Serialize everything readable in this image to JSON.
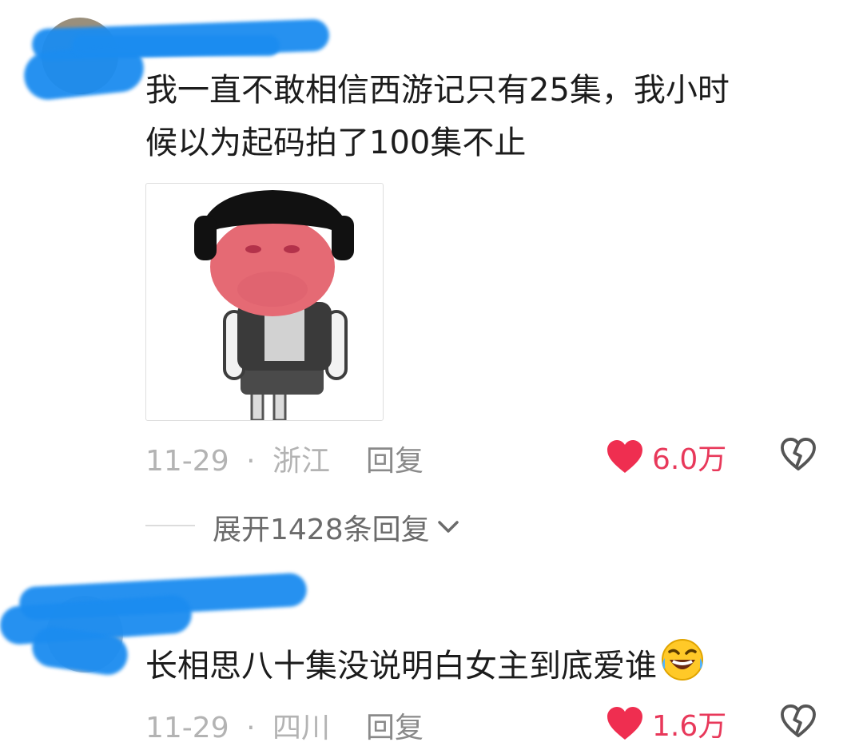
{
  "comments": [
    {
      "text_line1": "我一直不敢相信西游记只有25集，我小时",
      "text_line2": "候以为起码拍了100集不止",
      "date": "11-29",
      "separator": "·",
      "location": "浙江",
      "reply_label": "回复",
      "like_count": "6.0万",
      "has_sticker": true,
      "expand_label": "展开1428条回复"
    },
    {
      "text": "长相思八十集没说明白女主到底爱谁",
      "emoji": "laughing-crying-emoji",
      "date": "11-29",
      "separator": "·",
      "location": "四川",
      "reply_label": "回复",
      "like_count": "1.6万"
    }
  ],
  "colors": {
    "like": "#e8385a",
    "meta": "#b3b3b3",
    "redaction": "#1b8cf0"
  },
  "icons": [
    "heart-icon",
    "broken-heart-icon",
    "chevron-down-icon"
  ]
}
